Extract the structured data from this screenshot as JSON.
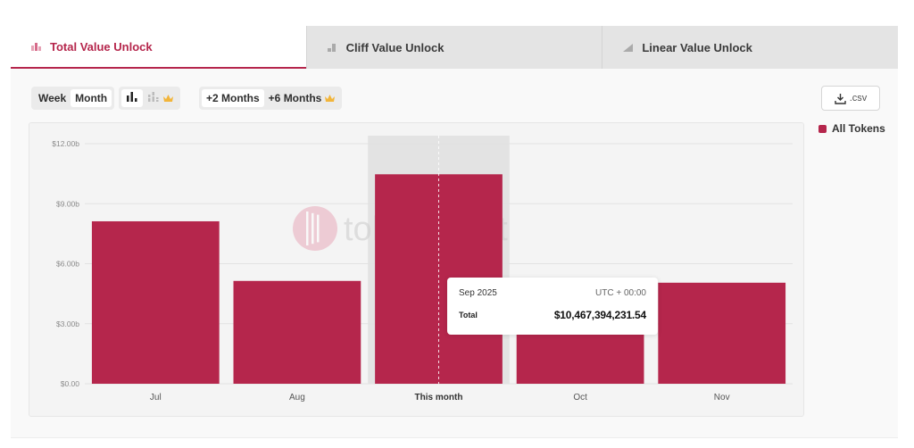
{
  "tabs": [
    {
      "label": "Total Value Unlock",
      "icon": "stacked-bars-icon",
      "active": true
    },
    {
      "label": "Cliff Value Unlock",
      "icon": "cliff-bars-icon",
      "active": false
    },
    {
      "label": "Linear Value Unlock",
      "icon": "linear-ramp-icon",
      "active": false
    }
  ],
  "toolbar": {
    "week_label": "Week",
    "month_label": "Month",
    "plus2_label": "+2 Months",
    "plus6_label": "+6 Months",
    "csv_label": ".csv"
  },
  "legend": {
    "label": "All Tokens",
    "color": "#b5264c"
  },
  "watermark": "tokenomist",
  "tooltip": {
    "date": "Sep 2025",
    "timezone": "UTC + 00:00",
    "label": "Total",
    "value": "$10,467,394,231.54"
  },
  "colors": {
    "accent": "#b5264c",
    "bar": "#b5264c",
    "highlight_band": "#e3e3e3",
    "grid": "#e2e2e2"
  },
  "chart_data": {
    "type": "bar",
    "categories": [
      "Jul",
      "Aug",
      "This month",
      "Oct",
      "Nov"
    ],
    "values": [
      8.12,
      5.14,
      10.47,
      4.95,
      5.05
    ],
    "y_unit": "billions USD",
    "ylim": [
      0,
      12
    ],
    "yticks": [
      0,
      3,
      6,
      9,
      12
    ],
    "ytick_labels": [
      "$0.00",
      "$3.00b",
      "$6.00b",
      "$9.00b",
      "$12.00b"
    ],
    "highlighted_index": 2,
    "grid": true,
    "legend_position": "top-right"
  }
}
